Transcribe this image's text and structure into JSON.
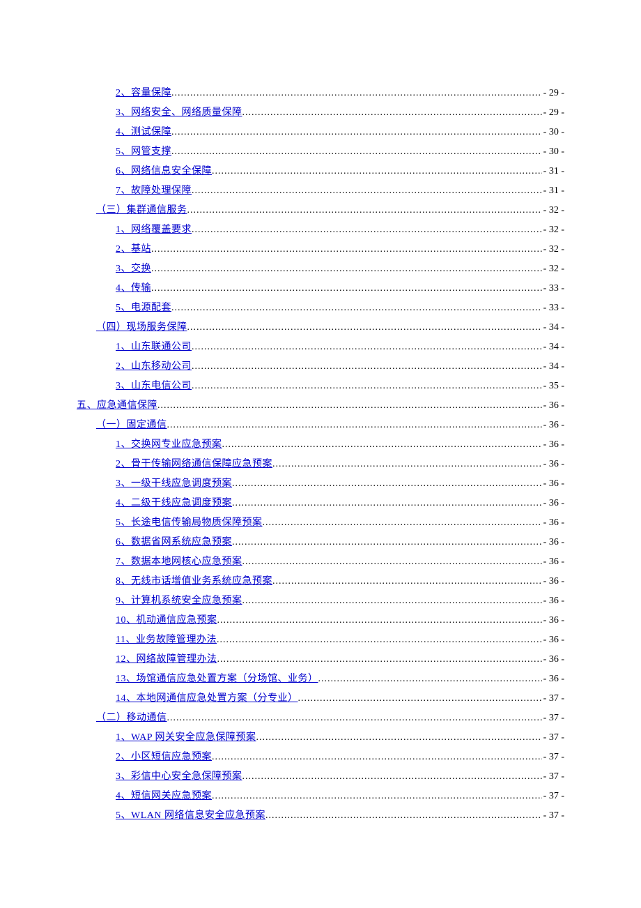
{
  "toc": [
    {
      "indent": 2,
      "label": "2、容量保障",
      "page": "- 29 -"
    },
    {
      "indent": 2,
      "label": "3、网络安全、网络质量保障",
      "page": "- 29 -"
    },
    {
      "indent": 2,
      "label": "4、测试保障",
      "page": "- 30 -"
    },
    {
      "indent": 2,
      "label": "5、网管支撑",
      "page": "- 30 -"
    },
    {
      "indent": 2,
      "label": "6、网络信息安全保障",
      "page": "- 31 -"
    },
    {
      "indent": 2,
      "label": "7、故障处理保障",
      "page": "- 31 -"
    },
    {
      "indent": 1,
      "label": "（三）集群通信服务",
      "page": "- 32 -"
    },
    {
      "indent": 2,
      "label": "1、网络覆盖要求",
      "page": "- 32 -"
    },
    {
      "indent": 2,
      "label": "2、基站",
      "page": "- 32 -"
    },
    {
      "indent": 2,
      "label": "3、交换",
      "page": "- 32 -"
    },
    {
      "indent": 2,
      "label": "4、传输",
      "page": "- 33 -"
    },
    {
      "indent": 2,
      "label": "5、电源配套",
      "page": "- 33 -"
    },
    {
      "indent": 1,
      "label": "（四）现场服务保障",
      "page": "- 34 -"
    },
    {
      "indent": 2,
      "label": "1、山东联通公司",
      "page": "- 34 -"
    },
    {
      "indent": 2,
      "label": "2、山东移动公司",
      "page": "- 34 -"
    },
    {
      "indent": 2,
      "label": "3、山东电信公司",
      "page": "- 35 -"
    },
    {
      "indent": 0,
      "label": "五、应急通信保障",
      "page": "- 36 -"
    },
    {
      "indent": 1,
      "label": "（一）固定通信",
      "page": "- 36 -"
    },
    {
      "indent": 2,
      "label": "1、交换网专业应急预案",
      "page": "- 36 -"
    },
    {
      "indent": 2,
      "label": "2、骨干传输网络通信保障应急预案",
      "page": "- 36 -"
    },
    {
      "indent": 2,
      "label": "3、一级干线应急调度预案",
      "page": "- 36 -"
    },
    {
      "indent": 2,
      "label": "4、二级干线应急调度预案",
      "page": "- 36 -"
    },
    {
      "indent": 2,
      "label": "5、长途电信传输局物质保障预案",
      "page": "- 36 -"
    },
    {
      "indent": 2,
      "label": "6、数据省网系统应急预案",
      "page": "- 36 -"
    },
    {
      "indent": 2,
      "label": "7、数据本地网核心应急预案",
      "page": "- 36 -"
    },
    {
      "indent": 2,
      "label": "8、无线市话增值业务系统应急预案",
      "page": "- 36 -"
    },
    {
      "indent": 2,
      "label": "9、计算机系统安全应急预案",
      "page": "- 36 -"
    },
    {
      "indent": 2,
      "label": "10、机动通信应急预案",
      "page": "- 36 -"
    },
    {
      "indent": 2,
      "label": "11、业务故障管理办法",
      "page": "- 36 -"
    },
    {
      "indent": 2,
      "label": "12、网络故障管理办法",
      "page": "- 36 -"
    },
    {
      "indent": 2,
      "label": "13、场馆通信应急处置方案（分场馆、业务）",
      "page": "- 36 -"
    },
    {
      "indent": 2,
      "label": "14、本地网通信应急处置方案（分专业）",
      "page": "- 37 -"
    },
    {
      "indent": 1,
      "label": "（二）移动通信",
      "page": "- 37 -"
    },
    {
      "indent": 2,
      "label": "1、WAP 网关安全应急保障预案",
      "page": "- 37 -"
    },
    {
      "indent": 2,
      "label": "2、小区短信应急预案",
      "page": "- 37 -"
    },
    {
      "indent": 2,
      "label": "3、彩信中心安全急保障预案",
      "page": "- 37 -"
    },
    {
      "indent": 2,
      "label": "4、短信网关应急预案",
      "page": "- 37 -"
    },
    {
      "indent": 2,
      "label": "5、WLAN 网络信息安全应急预案",
      "page": "- 37 -"
    }
  ]
}
